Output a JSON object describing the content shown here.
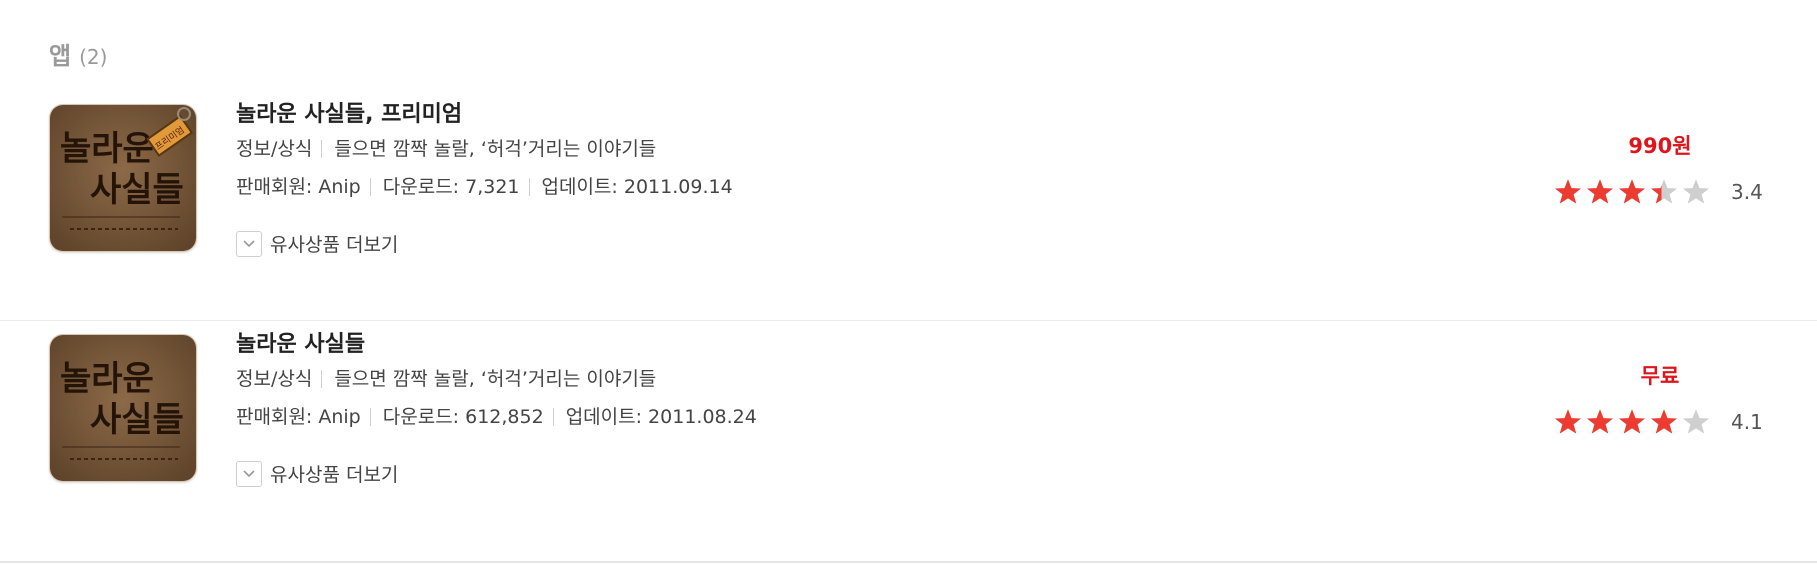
{
  "section": {
    "title": "앱",
    "count": "(2)"
  },
  "apps": [
    {
      "title": "놀라운 사실들, 프리미엄",
      "category": "정보/상식",
      "description": "들으면 깜짝 놀랄, ‘허걱’거리는 이야기들",
      "seller": "판매회원: Anip",
      "downloads": "다운로드: 7,321",
      "updated": "업데이트: 2011.09.14",
      "more_label": "유사상품 더보기",
      "price": "990원",
      "rating": "3.4",
      "icon_text_line1": "놀라운",
      "icon_text_line2": "사실들",
      "icon_badge": "프리미엄"
    },
    {
      "title": "놀라운 사실들",
      "category": "정보/상식",
      "description": "들으면 깜짝 놀랄, ‘허걱’거리는 이야기들",
      "seller": "판매회원: Anip",
      "downloads": "다운로드: 612,852",
      "updated": "업데이트: 2011.08.24",
      "more_label": "유사상품 더보기",
      "price": "무료",
      "rating": "4.1",
      "icon_text_line1": "놀라운",
      "icon_text_line2": "사실들"
    }
  ],
  "colors": {
    "price": "#e0151c",
    "star_filled": "#ec3b30",
    "star_empty": "#cfcfcf",
    "secondary_text": "#9a9a9a"
  },
  "icons": {
    "expand": "chevron-down-icon",
    "rating": "star-icon"
  }
}
